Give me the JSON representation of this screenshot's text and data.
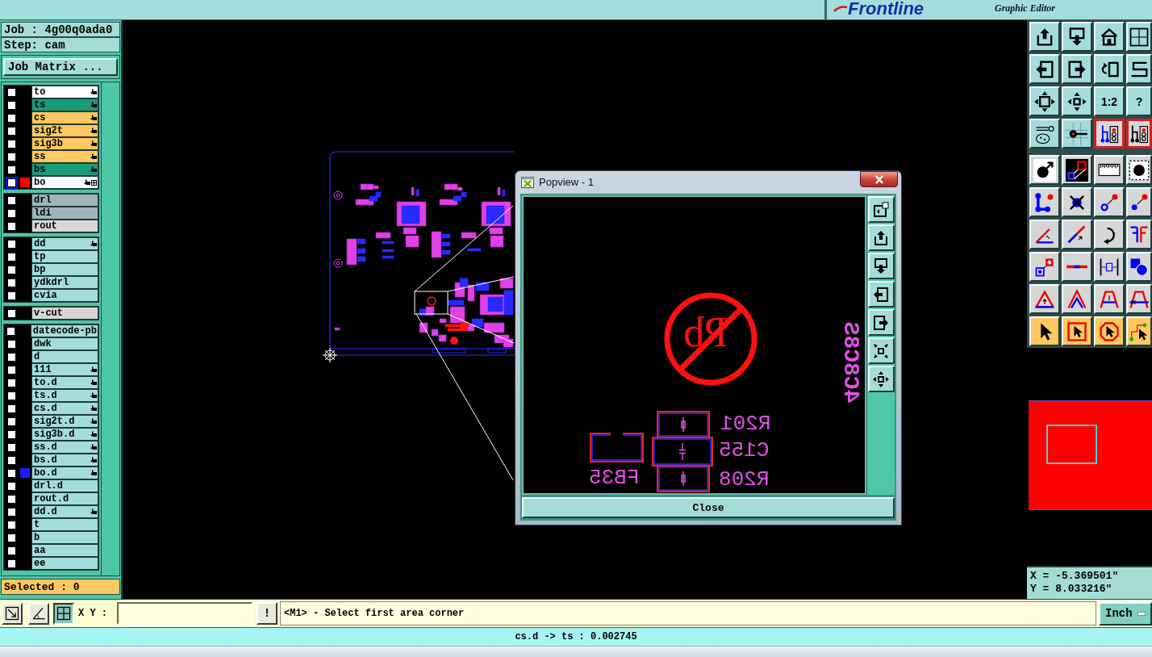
{
  "title_bar": {
    "logo": "Frontline",
    "subtitle": "Graphic Editor"
  },
  "job_panel": {
    "job": "Job : 4g00q0ada0",
    "step": "Step: cam",
    "job_matrix_button": "Job Matrix ..."
  },
  "layer_groups": [
    {
      "layers": [
        {
          "name": "to",
          "kind": "silk",
          "checked": false,
          "selected": false,
          "flagged": true,
          "linked": false
        },
        {
          "name": "ts",
          "kind": "mask",
          "checked": false,
          "selected": false,
          "flagged": true,
          "linked": false
        },
        {
          "name": "cs",
          "kind": "signal",
          "checked": false,
          "selected": false,
          "flagged": true,
          "linked": false
        },
        {
          "name": "sig2t",
          "kind": "signal",
          "checked": false,
          "selected": false,
          "flagged": true,
          "linked": false
        },
        {
          "name": "sig3b",
          "kind": "signal",
          "checked": false,
          "selected": false,
          "flagged": true,
          "linked": false
        },
        {
          "name": "ss",
          "kind": "signal",
          "checked": false,
          "selected": false,
          "flagged": true,
          "linked": false
        },
        {
          "name": "bs",
          "kind": "mask",
          "checked": false,
          "selected": false,
          "flagged": true,
          "linked": false
        },
        {
          "name": "bo",
          "kind": "silk",
          "checked": false,
          "selected": true,
          "flagged": true,
          "linked": true,
          "color": "#ff0000"
        }
      ]
    },
    {
      "layers": [
        {
          "name": "drl",
          "kind": "drill",
          "checked": false,
          "selected": false,
          "flagged": false,
          "linked": false
        },
        {
          "name": "ldi",
          "kind": "drill",
          "checked": false,
          "selected": false,
          "flagged": false,
          "linked": false
        },
        {
          "name": "rout",
          "kind": "rout",
          "checked": false,
          "selected": false,
          "flagged": false,
          "linked": false
        }
      ]
    },
    {
      "layers": [
        {
          "name": "dd",
          "kind": "doc",
          "checked": false,
          "selected": false,
          "flagged": true,
          "linked": false
        },
        {
          "name": "tp",
          "kind": "doc",
          "checked": false,
          "selected": false,
          "flagged": false,
          "linked": false
        },
        {
          "name": "bp",
          "kind": "doc",
          "checked": false,
          "selected": false,
          "flagged": false,
          "linked": false
        },
        {
          "name": "ydkdrl",
          "kind": "doc",
          "checked": false,
          "selected": false,
          "flagged": false,
          "linked": false
        },
        {
          "name": "cvia",
          "kind": "doc",
          "checked": false,
          "selected": false,
          "flagged": false,
          "linked": false
        }
      ]
    },
    {
      "layers": [
        {
          "name": "v-cut",
          "kind": "rout",
          "checked": false,
          "selected": false,
          "flagged": false,
          "linked": false
        }
      ]
    },
    {
      "layers": [
        {
          "name": "datecode-pb",
          "kind": "doc",
          "checked": false,
          "selected": false,
          "flagged": false,
          "linked": false
        },
        {
          "name": "dwk",
          "kind": "doc",
          "checked": false,
          "selected": false,
          "flagged": false,
          "linked": false
        },
        {
          "name": "d",
          "kind": "doc",
          "checked": false,
          "selected": false,
          "flagged": false,
          "linked": false
        },
        {
          "name": "111",
          "kind": "doc",
          "checked": false,
          "selected": false,
          "flagged": true,
          "linked": false
        },
        {
          "name": "to.d",
          "kind": "doc",
          "checked": false,
          "selected": false,
          "flagged": true,
          "linked": false
        },
        {
          "name": "ts.d",
          "kind": "doc",
          "checked": false,
          "selected": false,
          "flagged": true,
          "linked": false
        },
        {
          "name": "cs.d",
          "kind": "doc",
          "checked": false,
          "selected": false,
          "flagged": true,
          "linked": false
        },
        {
          "name": "sig2t.d",
          "kind": "doc",
          "checked": false,
          "selected": false,
          "flagged": true,
          "linked": false
        },
        {
          "name": "sig3b.d",
          "kind": "doc",
          "checked": false,
          "selected": false,
          "flagged": true,
          "linked": false
        },
        {
          "name": "ss.d",
          "kind": "doc",
          "checked": false,
          "selected": false,
          "flagged": true,
          "linked": false
        },
        {
          "name": "bs.d",
          "kind": "doc",
          "checked": false,
          "selected": false,
          "flagged": true,
          "linked": false
        },
        {
          "name": "bo.d",
          "kind": "doc",
          "checked": false,
          "selected": false,
          "flagged": true,
          "linked": false,
          "color": "#1c1cff"
        },
        {
          "name": "drl.d",
          "kind": "doc",
          "checked": false,
          "selected": false,
          "flagged": false,
          "linked": false
        },
        {
          "name": "rout.d",
          "kind": "doc",
          "checked": false,
          "selected": false,
          "flagged": false,
          "linked": false
        },
        {
          "name": "dd.d",
          "kind": "doc",
          "checked": false,
          "selected": false,
          "flagged": true,
          "linked": false
        },
        {
          "name": "t",
          "kind": "doc",
          "checked": false,
          "selected": false,
          "flagged": false,
          "linked": false
        },
        {
          "name": "b",
          "kind": "doc",
          "checked": false,
          "selected": false,
          "flagged": false,
          "linked": false
        },
        {
          "name": "aa",
          "kind": "doc",
          "checked": false,
          "selected": false,
          "flagged": false,
          "linked": false
        },
        {
          "name": "ee",
          "kind": "doc",
          "checked": false,
          "selected": false,
          "flagged": false,
          "linked": false
        }
      ]
    }
  ],
  "selected_count": "Selected : 0",
  "toolbar": {
    "groups": [
      {
        "kind": "view",
        "buttons": [
          {
            "selected": false
          },
          {
            "selected": false
          },
          {
            "selected": false
          },
          {
            "selected": false
          },
          {
            "selected": false
          },
          {
            "selected": false
          },
          {
            "selected": false
          },
          {
            "selected": false
          },
          {
            "selected": false
          },
          {
            "selected": false
          },
          {
            "selected": false,
            "label": "1:2"
          },
          {
            "selected": false,
            "label": "?"
          },
          {
            "selected": false
          },
          {
            "selected": false
          },
          {
            "selected": true
          },
          {
            "selected": true
          }
        ]
      },
      {
        "kind": "edit",
        "buttons": [
          {
            "selected": false
          },
          {
            "selected": false
          },
          {
            "selected": false
          },
          {
            "selected": false
          },
          {
            "selected": false
          },
          {
            "selected": false
          },
          {
            "selected": false
          },
          {
            "selected": false
          },
          {
            "selected": false
          },
          {
            "selected": false
          },
          {
            "selected": false
          },
          {
            "selected": false
          },
          {
            "selected": false
          },
          {
            "selected": false
          },
          {
            "selected": false
          },
          {
            "selected": false
          },
          {
            "selected": false
          },
          {
            "selected": false
          },
          {
            "selected": false
          },
          {
            "selected": false
          }
        ]
      },
      {
        "kind": "select",
        "buttons": [
          {
            "selected": false
          },
          {
            "selected": false
          },
          {
            "selected": false
          },
          {
            "selected": false
          }
        ]
      }
    ]
  },
  "popview": {
    "title": "Popview - 1",
    "texts": [
      {
        "text": "Pb",
        "kind": "symbol"
      },
      {
        "text": "R201",
        "kind": "label"
      },
      {
        "text": "C155",
        "kind": "label"
      },
      {
        "text": "R208",
        "kind": "label"
      },
      {
        "text": "FB35",
        "kind": "label"
      },
      {
        "text": "4C8C8S",
        "kind": "vertical"
      }
    ],
    "close_button": "Close"
  },
  "coordinates": {
    "x": "X = -5.369501\"",
    "y": "Y = 8.033216\""
  },
  "command_bar": {
    "tools": [
      {
        "selected": false
      },
      {
        "selected": false
      },
      {
        "selected": true
      }
    ],
    "xy_label": "X Y :",
    "alert_button": "!",
    "message": "<M1> - Select first area corner",
    "units": "Inch"
  },
  "status_bar": {
    "text": "cs.d -> ts : 0.002745"
  }
}
